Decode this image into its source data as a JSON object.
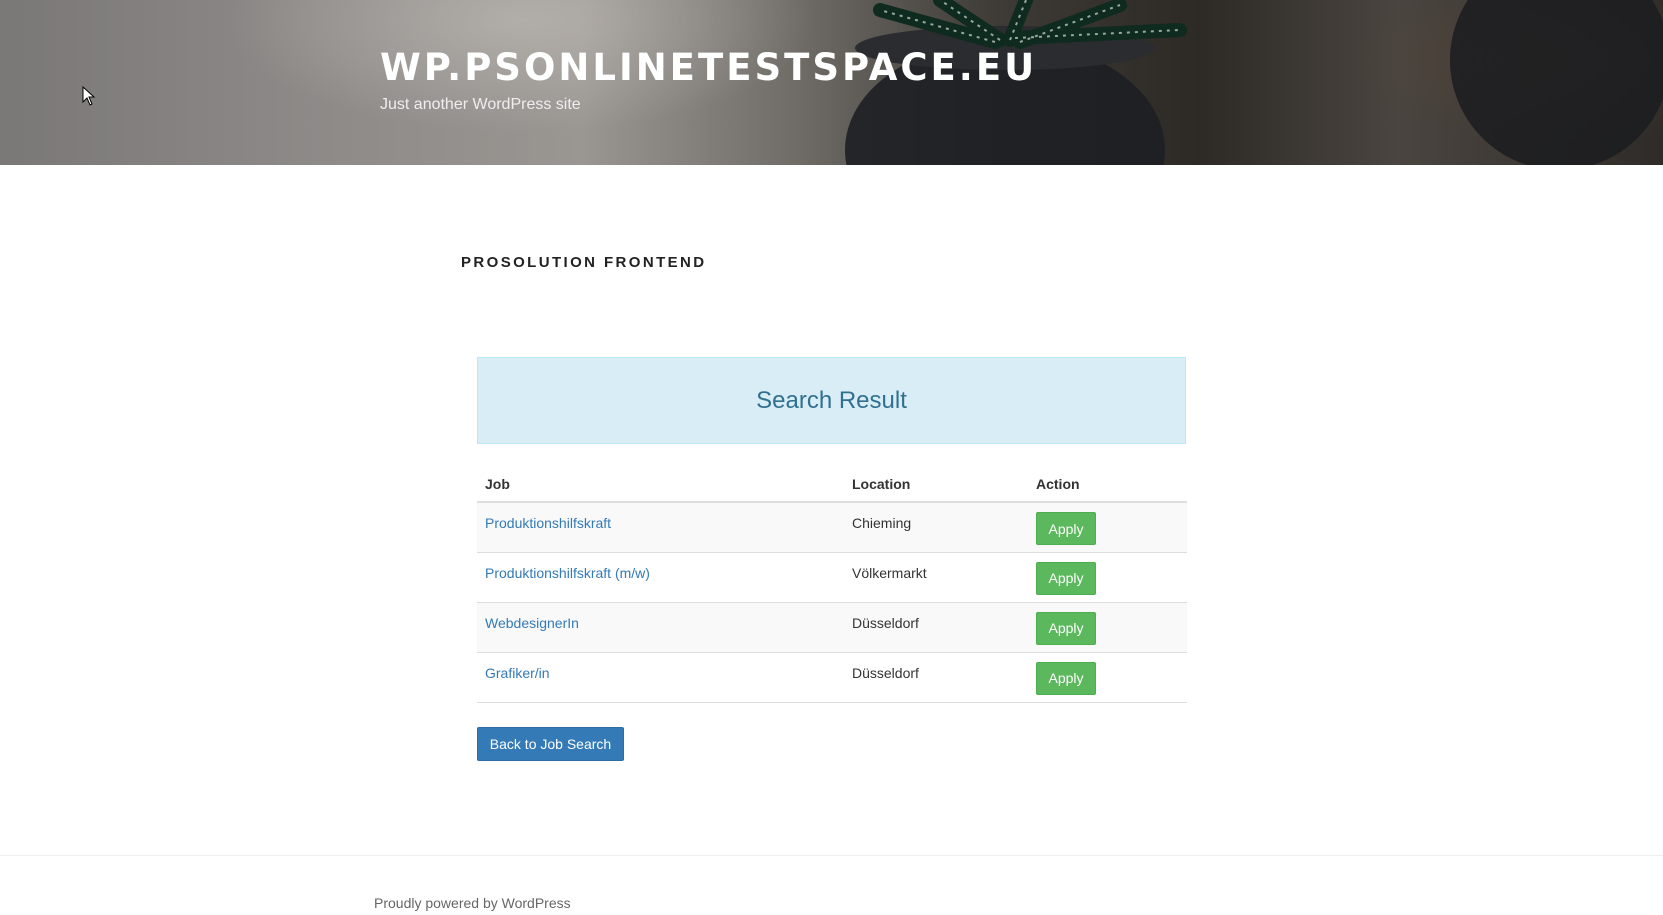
{
  "header": {
    "site_title": "WP.PSONLINETESTSPACE.EU",
    "tagline": "Just another WordPress site"
  },
  "page": {
    "title": "PROSOLUTION FRONTEND"
  },
  "search_result": {
    "heading": "Search Result",
    "columns": {
      "job": "Job",
      "location": "Location",
      "action": "Action"
    },
    "rows": [
      {
        "job": "Produktionshilfskraft",
        "location": "Chieming",
        "action": "Apply"
      },
      {
        "job": "Produktionshilfskraft (m/w)",
        "location": "Völkermarkt",
        "action": "Apply"
      },
      {
        "job": "WebdesignerIn",
        "location": "Düsseldorf",
        "action": "Apply"
      },
      {
        "job": "Grafiker/in",
        "location": "Düsseldorf",
        "action": "Apply"
      }
    ],
    "back_button": "Back to Job Search"
  },
  "footer": {
    "credit": "Proudly powered by WordPress"
  },
  "colors": {
    "apply_button": "#5cb85c",
    "back_button": "#337ab7",
    "panel_background": "#d9edf7",
    "link": "#337ab7"
  },
  "icons": {
    "cursor": "mouse-pointer-icon",
    "header_image": "succulent-plant-photo"
  }
}
